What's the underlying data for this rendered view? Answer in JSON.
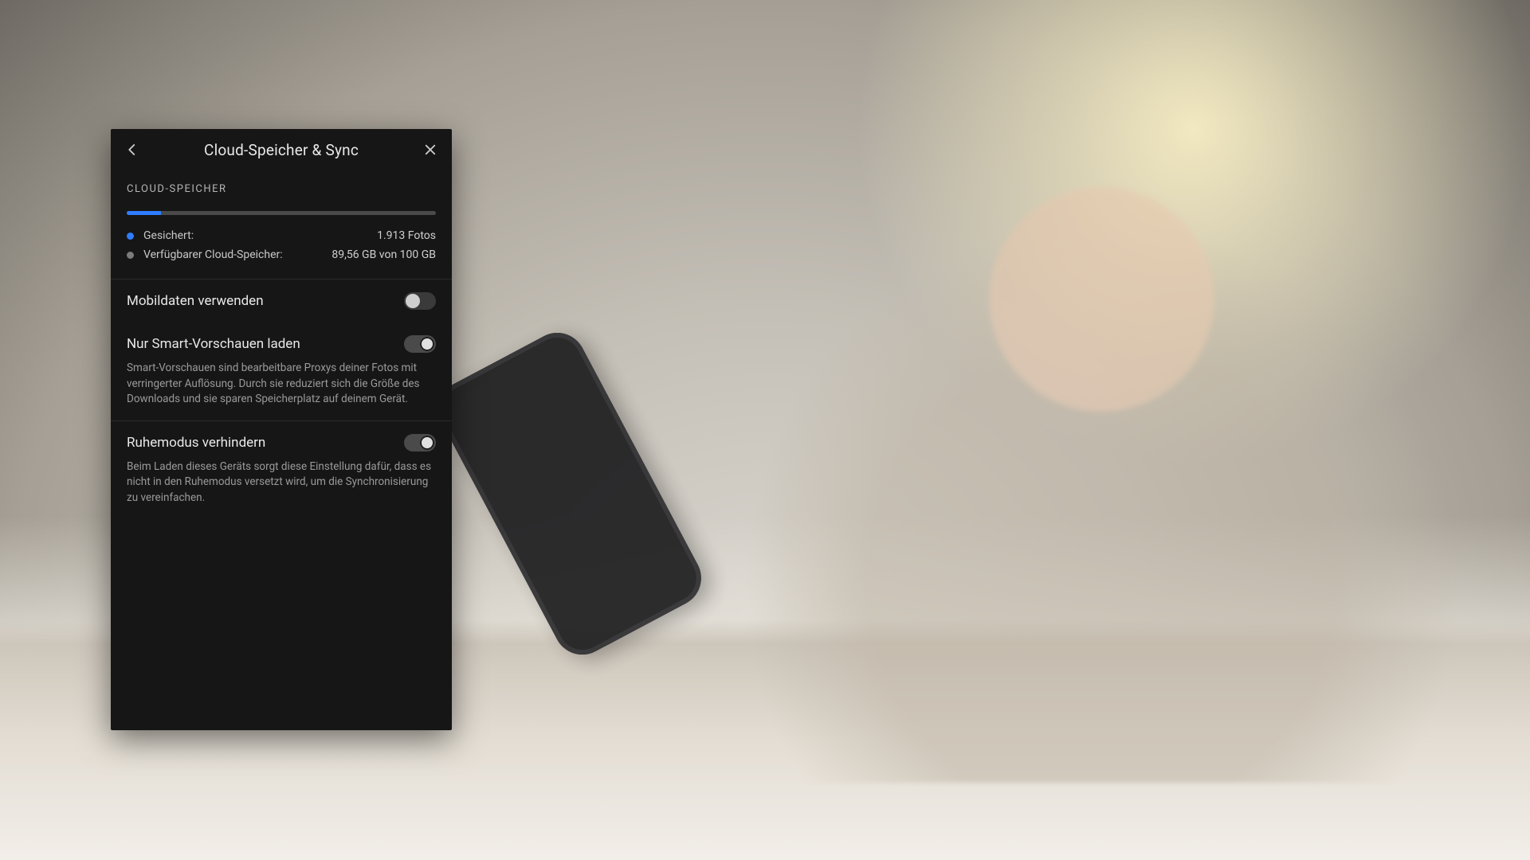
{
  "panel": {
    "title": "Cloud-Speicher & Sync",
    "section_label": "CLOUD-SPEICHER",
    "storage": {
      "used_pct": 11,
      "rows": [
        {
          "dot": "blue",
          "label": "Gesichert:",
          "value": "1.913 Fotos"
        },
        {
          "dot": "grey",
          "label": "Verfügbarer Cloud-Speicher:",
          "value": "89,56 GB von 100 GB"
        }
      ]
    },
    "settings": [
      {
        "key": "mobile-data",
        "title": "Mobildaten verwenden",
        "enabled": false,
        "desc": null
      },
      {
        "key": "smart-previews",
        "title": "Nur Smart-Vorschauen laden",
        "enabled": true,
        "desc": "Smart-Vorschauen sind bearbeitbare Proxys deiner Fotos mit verringerter Auflösung. Durch sie reduziert sich die Größe des Downloads und sie sparen Speicherplatz auf deinem Gerät."
      },
      {
        "key": "prevent-sleep",
        "title": "Ruhemodus verhindern",
        "enabled": true,
        "desc": "Beim Laden dieses Geräts sorgt diese Einstellung dafür, dass es nicht in den Ruhemodus versetzt wird, um die Synchronisierung zu vereinfachen."
      }
    ]
  },
  "colors": {
    "accent": "#2f7dff"
  }
}
